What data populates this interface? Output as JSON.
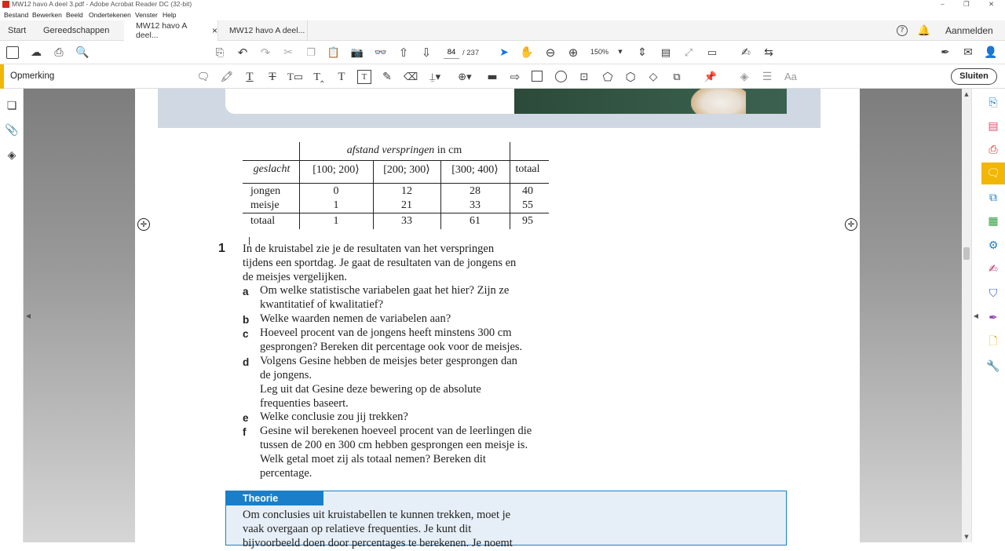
{
  "window": {
    "title": "MW12 havo A deel 3.pdf - Adobe Acrobat Reader DC (32-bit)",
    "controls": [
      "–",
      "❐",
      "✕"
    ]
  },
  "menu": [
    "Bestand",
    "Bewerken",
    "Beeld",
    "Ondertekenen",
    "Venster",
    "Help"
  ],
  "tabs": {
    "home": "Start",
    "tools": "Gereedschappen",
    "doc1": "MW12 havo A deel...",
    "doc1_close": "×",
    "doc2": "MW12 havo A deel...",
    "signin": "Aanmelden"
  },
  "toolbar": {
    "page_current": "84",
    "page_total": "/ 237",
    "zoom": "150%"
  },
  "commentbar": {
    "label": "Opmerking",
    "close": "Sluiten",
    "font_label": "Aa"
  },
  "table": {
    "header": "afstand verspringen",
    "header_unit": " in cm",
    "col_geslacht": "geslacht",
    "intervals": [
      "[100; 200⟩",
      "[200; 300⟩",
      "[300; 400⟩"
    ],
    "col_totaal": "totaal",
    "rows": [
      {
        "label": "jongen",
        "values": [
          "0",
          "12",
          "28",
          "40"
        ]
      },
      {
        "label": "meisje",
        "values": [
          "1",
          "21",
          "33",
          "55"
        ]
      },
      {
        "label": "totaal",
        "values": [
          "1",
          "33",
          "61",
          "95"
        ]
      }
    ]
  },
  "exercise": {
    "number": "1",
    "intro": [
      "In de kruistabel zie je de resultaten van het verspringen",
      "tijdens een sportdag. Je gaat de resultaten van de jongens en",
      "de meisjes vergelijken."
    ],
    "items": [
      {
        "letter": "a",
        "lines": [
          "Om welke statistische variabelen gaat het hier? Zijn ze",
          "kwantitatief of kwalitatief?"
        ]
      },
      {
        "letter": "b",
        "lines": [
          "Welke waarden nemen de variabelen aan?"
        ]
      },
      {
        "letter": "c",
        "lines": [
          "Hoeveel procent van de jongens heeft minstens 300 cm",
          "gesprongen? Bereken dit percentage ook voor de meisjes."
        ]
      },
      {
        "letter": "d",
        "lines": [
          "Volgens Gesine hebben de meisjes beter gesprongen dan",
          "de jongens.",
          "Leg uit dat Gesine deze bewering op de absolute",
          "frequenties baseert."
        ]
      },
      {
        "letter": "e",
        "lines": [
          "Welke conclusie zou jij trekken?"
        ]
      },
      {
        "letter": "f",
        "lines": [
          "Gesine wil berekenen hoeveel procent van de leerlingen die",
          "tussen de 200 en 300 cm hebben gesprongen een meisje is.",
          "Welk getal moet zij als totaal nemen? Bereken dit",
          "percentage."
        ]
      }
    ]
  },
  "theorie": {
    "title": "Theorie",
    "lines": [
      "Om conclusies uit kruistabellen te kunnen trekken, moet je",
      "vaak overgaan op relatieve frequenties. Je kunt dit",
      "bijvoorbeeld doen door percentages te berekenen. Je noemt"
    ]
  },
  "colors": {
    "accent_yellow": "#f2b705",
    "theorie_blue": "#1a7fc8",
    "theorie_bg": "#e6eff7",
    "photo_green": "#2c4a3a",
    "band_grey": "#cfd8e3"
  }
}
